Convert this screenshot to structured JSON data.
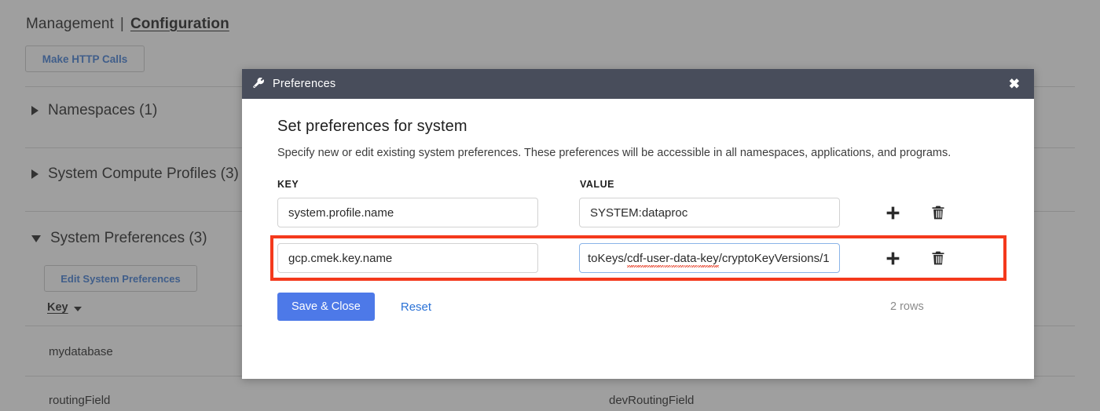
{
  "background": {
    "breadcrumb": {
      "root": "Management",
      "separator": "|",
      "active": "Configuration"
    },
    "http_button_label": "Make HTTP Calls",
    "sections": [
      {
        "label": "Namespaces (1)",
        "expanded": false
      },
      {
        "label": "System Compute Profiles (3)",
        "expanded": false
      },
      {
        "label": "System Preferences (3)",
        "expanded": true
      }
    ],
    "edit_preferences_button": "Edit System Preferences",
    "table": {
      "column_header": "Key",
      "rows": [
        {
          "key": "mydatabase",
          "value": ""
        },
        {
          "key": "routingField",
          "value": "devRoutingField"
        }
      ]
    }
  },
  "modal": {
    "title": "Preferences",
    "title_icon": "wrench-icon",
    "close_icon": "close-icon",
    "heading": "Set preferences for system",
    "description": "Specify new or edit existing system preferences. These preferences will be accessible in all namespaces, applications, and programs.",
    "columns": {
      "key": "KEY",
      "value": "VALUE"
    },
    "rows": [
      {
        "key": "system.profile.name",
        "value": "SYSTEM:dataproc",
        "highlighted": false,
        "value_focused": false,
        "add_icon": "plus-icon",
        "delete_icon": "trash-icon"
      },
      {
        "key": "gcp.cmek.key.name",
        "value_prefix": "toKeys/",
        "value_misspelled": "cdf-user-data-key",
        "value_suffix": "/cryptoKeyVersions/1",
        "value": "toKeys/cdf-user-data-key/cryptoKeyVersions/1",
        "highlighted": true,
        "value_focused": true,
        "add_icon": "plus-icon",
        "delete_icon": "trash-icon"
      }
    ],
    "footer": {
      "save_label": "Save & Close",
      "reset_label": "Reset",
      "rows_count": "2 rows"
    }
  },
  "colors": {
    "modal_header_bg": "#484d5b",
    "overlay": "#7d7d7d",
    "primary_button": "#4d79e8",
    "link": "#2b72d6",
    "highlight_outline": "#f4391c",
    "focus_border": "#8ab4e8",
    "spellcheck_underline": "#e8412a"
  }
}
